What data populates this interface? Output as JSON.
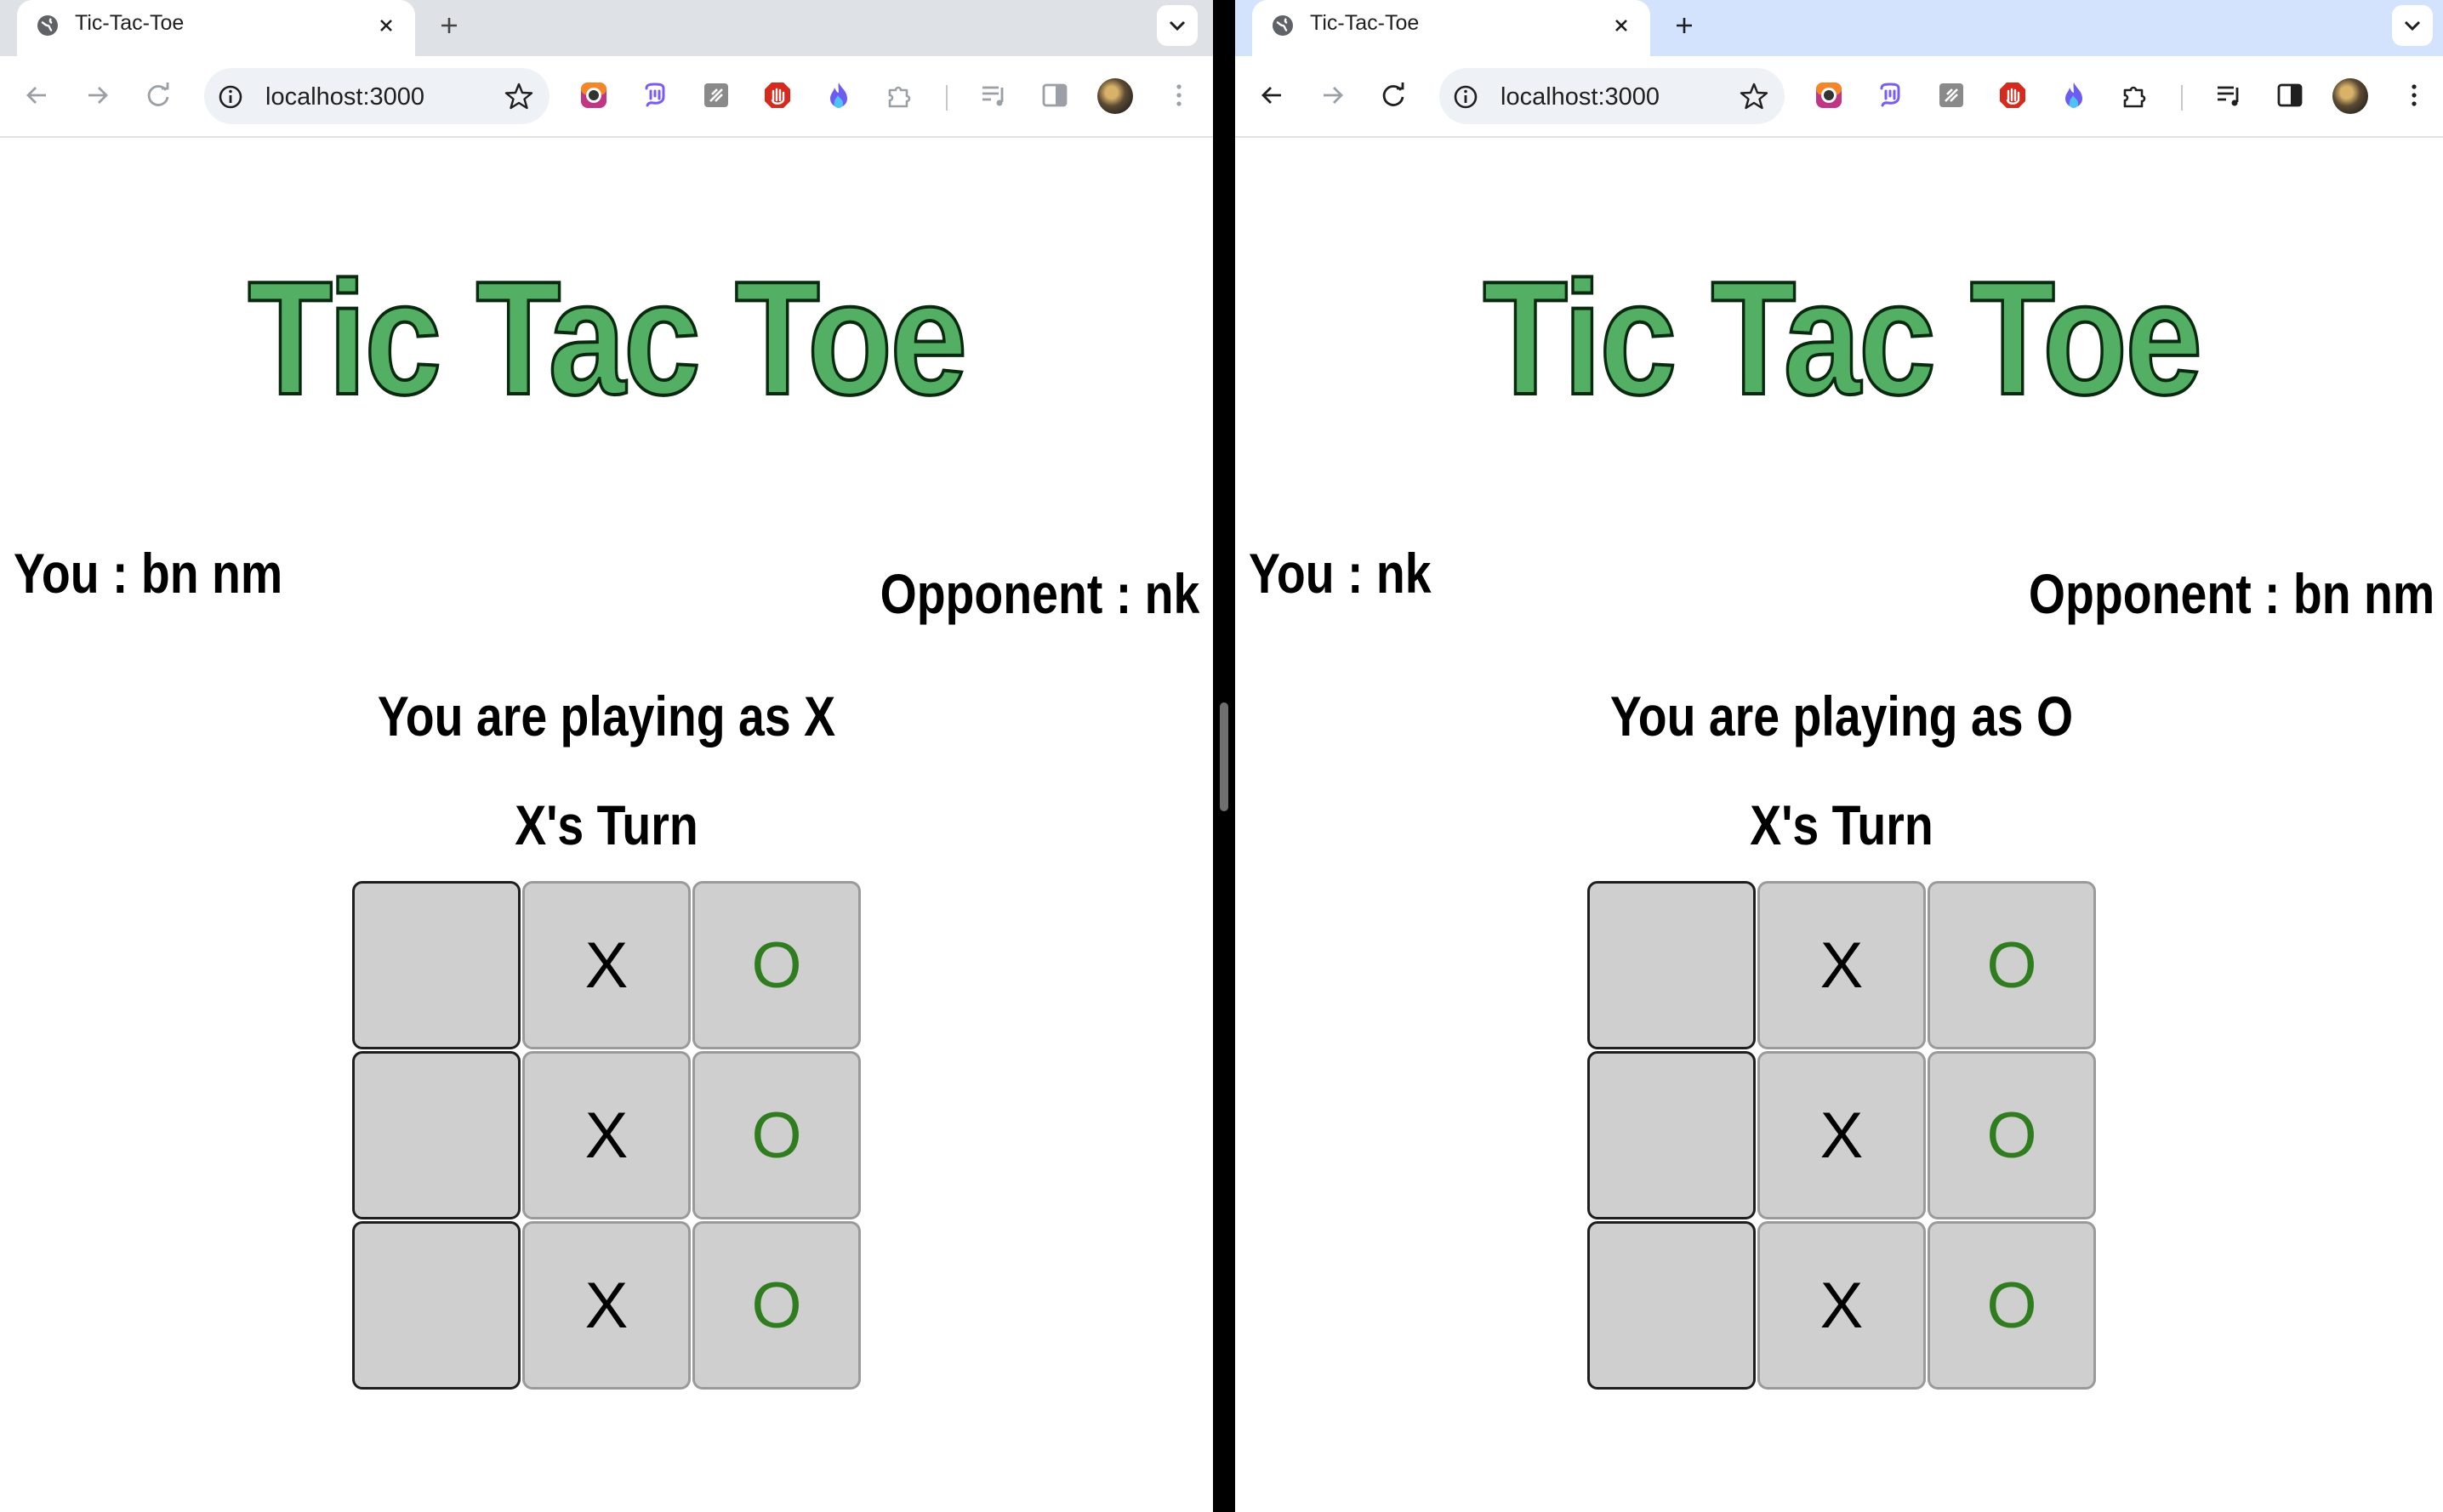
{
  "windows": [
    {
      "tab": {
        "title": "Tic-Tac-Toe"
      },
      "url": "localhost:3000",
      "game": {
        "title": "Tic Tac Toe",
        "you": "You : bn nm",
        "opponent": "Opponent : nk",
        "playing_as": "You are playing as X",
        "turn": "X's Turn",
        "board": [
          [
            "",
            "X",
            "O"
          ],
          [
            "",
            "X",
            "O"
          ],
          [
            "",
            "X",
            "O"
          ]
        ]
      }
    },
    {
      "tab": {
        "title": "Tic-Tac-Toe"
      },
      "url": "localhost:3000",
      "game": {
        "title": "Tic Tac Toe",
        "you": "You : nk",
        "opponent": "Opponent : bn nm",
        "playing_as": "You are playing as O",
        "turn": "X's Turn",
        "board": [
          [
            "",
            "X",
            "O"
          ],
          [
            "",
            "X",
            "O"
          ],
          [
            "",
            "X",
            "O"
          ]
        ]
      }
    }
  ],
  "icons": {
    "tab_favicon": "globe-icon",
    "tab_close": "close-icon",
    "new_tab": "plus-icon",
    "tab_search": "chevron-down-icon",
    "back": "arrow-left-icon",
    "forward": "arrow-right-icon",
    "reload": "reload-icon",
    "site_info": "info-icon",
    "bookmark": "star-icon",
    "extensions": [
      "chrome-ext-icon",
      "mastodon-ext-icon",
      "notes-ext-icon",
      "adblock-ext-icon",
      "flame-ext-icon",
      "puzzle-icon"
    ],
    "media": "media-controls-icon",
    "side_panel": "side-panel-icon",
    "menu": "kebab-menu-icon"
  },
  "colors": {
    "title_fill": "#52af63",
    "title_stroke": "#0a2a10",
    "o_mark": "#2f7d1f",
    "cell_bg": "#d0cfcf",
    "tabstrip_left": "#dee1e6",
    "tabstrip_right": "#d3e3fd"
  }
}
